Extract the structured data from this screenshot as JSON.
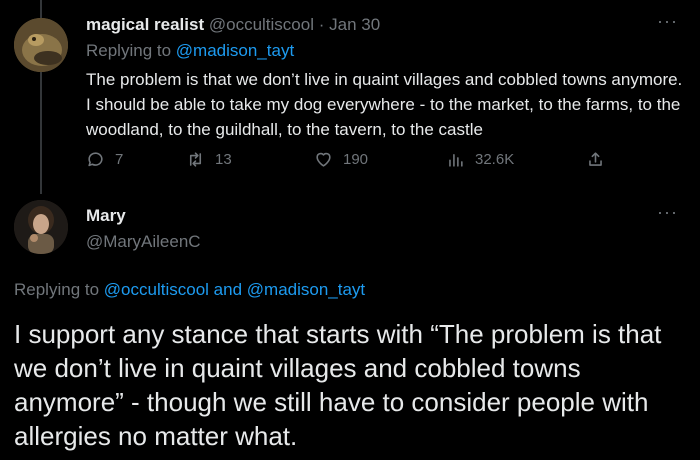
{
  "tweet1": {
    "display_name": "magical realist",
    "handle": "@occultiscool",
    "separator": "·",
    "date": "Jan 30",
    "replying_prefix": "Replying to",
    "replying_to": "@madison_tayt",
    "text": "The problem is that we don’t live in quaint villages and cobbled towns anymore. I should be able to take my dog everywhere - to the market, to the farms, to the woodland, to the guildhall, to the tavern, to the castle",
    "metrics": {
      "replies": "7",
      "retweets": "13",
      "likes": "190",
      "views": "32.6K"
    }
  },
  "tweet2": {
    "display_name": "Mary",
    "handle": "@MaryAileenC",
    "replying_prefix": "Replying to",
    "replying_to_1": "@occultiscool",
    "replying_and": "and",
    "replying_to_2": "@madison_tayt",
    "text": "I support any stance that starts with “The problem is that we don’t live in quaint villages and cobbled towns anymore” - though we still have to consider people with allergies no matter what."
  },
  "colors": {
    "background": "#000000",
    "text": "#e7e9ea",
    "muted": "#71767b",
    "link": "#1d9bf0"
  },
  "icons": {
    "more": "more-horizontal-icon",
    "reply": "reply-icon",
    "retweet": "retweet-icon",
    "like": "heart-icon",
    "views": "views-chart-icon",
    "share": "share-icon"
  }
}
